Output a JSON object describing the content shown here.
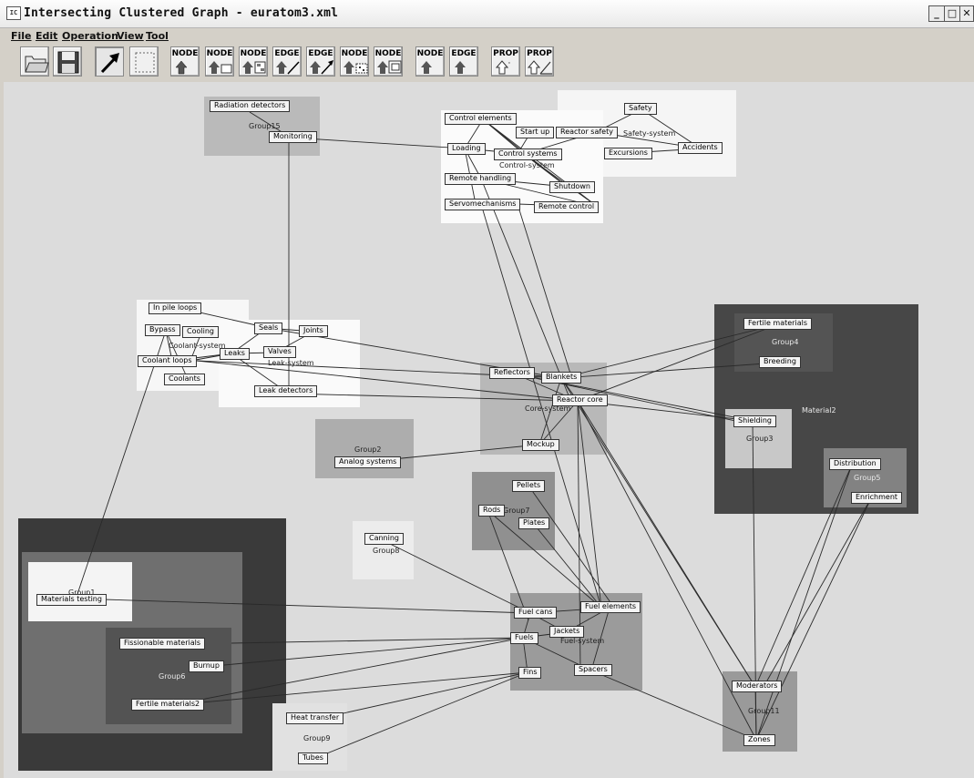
{
  "window": {
    "title": "Intersecting Clustered Graph - euratom3.xml",
    "app_icon_text": "IC",
    "controls": [
      "_",
      "□",
      "✕"
    ]
  },
  "menu": [
    "File",
    "Edit",
    "Operation",
    "View",
    "Tool"
  ],
  "toolbar": {
    "node_label": "NODE",
    "edge_label": "EDGE",
    "prop_label": "PROP"
  },
  "groups": {
    "group15": "Group15",
    "control_system": "Control-system",
    "safety_system": "Safety-system",
    "coolant_system": "Coolant-system",
    "leak_system": "Leak-system",
    "core_system": "Core-system",
    "group2": "Group2",
    "group7": "Group7",
    "group8": "Group8",
    "group1": "Group1",
    "group6": "Group6",
    "group9": "Group9",
    "fuel_system": "Fuel-system",
    "group11": "Group11",
    "material2": "Material2",
    "group4": "Group4",
    "group3": "Group3",
    "group5": "Group5"
  },
  "nodes": {
    "radiation_detectors": "Radiation detectors",
    "monitoring": "Monitoring",
    "control_elements": "Control elements",
    "start_up": "Start up",
    "loading": "Loading",
    "control_systems": "Control systems",
    "remote_handling": "Remote handling",
    "shutdown": "Shutdown",
    "servomechanisms": "Servomechanisms",
    "remote_control": "Remote control",
    "safety": "Safety",
    "reactor_safety": "Reactor safety",
    "accidents": "Accidents",
    "excursions": "Excursions",
    "in_pile_loops": "In pile loops",
    "bypass": "Bypass",
    "cooling": "Cooling",
    "seals": "Seals",
    "joints": "Joints",
    "leaks": "Leaks",
    "valves": "Valves",
    "coolant_loops": "Coolant loops",
    "coolants": "Coolants",
    "leak_detectors": "Leak detectors",
    "reflectors": "Reflectors",
    "blankets": "Blankets",
    "reactor_core": "Reactor core",
    "mockup": "Mockup",
    "analog_systems": "Analog systems",
    "fertile_materials": "Fertile materials",
    "breeding": "Breeding",
    "shielding": "Shielding",
    "distribution": "Distribution",
    "enrichment": "Enrichment",
    "pellets": "Pellets",
    "rods": "Rods",
    "plates": "Plates",
    "canning": "Canning",
    "materials_testing": "Materials testing",
    "fissionable_materials": "Fissionable materials",
    "burnup": "Burnup",
    "fertile_materials2": "Fertile materials2",
    "heat_transfer": "Heat transfer",
    "tubes": "Tubes",
    "fuel_cans": "Fuel cans",
    "fuel_elements": "Fuel elements",
    "jackets": "Jackets",
    "fuels": "Fuels",
    "fins": "Fins",
    "spacers": "Spacers",
    "moderators": "Moderators",
    "zones": "Zones"
  }
}
